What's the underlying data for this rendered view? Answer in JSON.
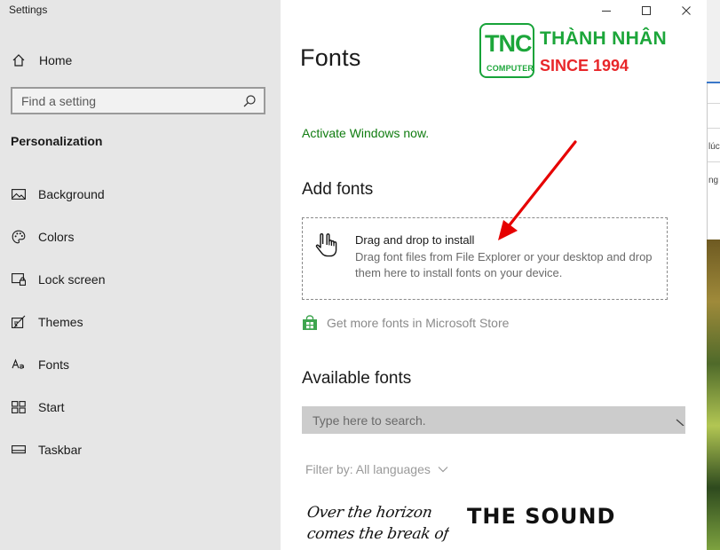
{
  "window": {
    "title": "Settings",
    "minimize_glyph": "—",
    "maximize_glyph": "☐",
    "close_glyph": "✕"
  },
  "nav": {
    "home_label": "Home",
    "search_placeholder": "Find a setting",
    "section": "Personalization",
    "items": [
      {
        "label": "Background",
        "icon": "image-icon"
      },
      {
        "label": "Colors",
        "icon": "palette-icon"
      },
      {
        "label": "Lock screen",
        "icon": "lock-screen-icon"
      },
      {
        "label": "Themes",
        "icon": "themes-icon"
      },
      {
        "label": "Fonts",
        "icon": "font-icon"
      },
      {
        "label": "Start",
        "icon": "start-icon"
      },
      {
        "label": "Taskbar",
        "icon": "taskbar-icon"
      }
    ]
  },
  "main": {
    "title": "Fonts",
    "activate_link": "Activate Windows now.",
    "add_fonts_heading": "Add fonts",
    "dropzone": {
      "title": "Drag and drop to install",
      "description": "Drag font files from File Explorer or your desktop and drop them here to install fonts on your device."
    },
    "store_link": "Get more fonts in Microsoft Store",
    "available_heading": "Available fonts",
    "font_search_placeholder": "Type here to search.",
    "filter_label": "Filter by: All languages",
    "previews": {
      "handwritten_line1": "Over the horizon",
      "handwritten_line2": "comes the break of",
      "stencil": "THE SOUND"
    }
  },
  "logo": {
    "badge_text": "TNC",
    "badge_subtext": "COMPUTER",
    "name": "THÀNH NHÂN",
    "since": "SINCE 1994"
  },
  "background_window": {
    "text1": "lúc",
    "text2": "ng"
  },
  "colors": {
    "nav_bg": "#e6e6e6",
    "activate_green": "#107c10",
    "logo_green": "#1ca63a",
    "logo_red": "#e8272a",
    "arrow_red": "#e60000"
  }
}
